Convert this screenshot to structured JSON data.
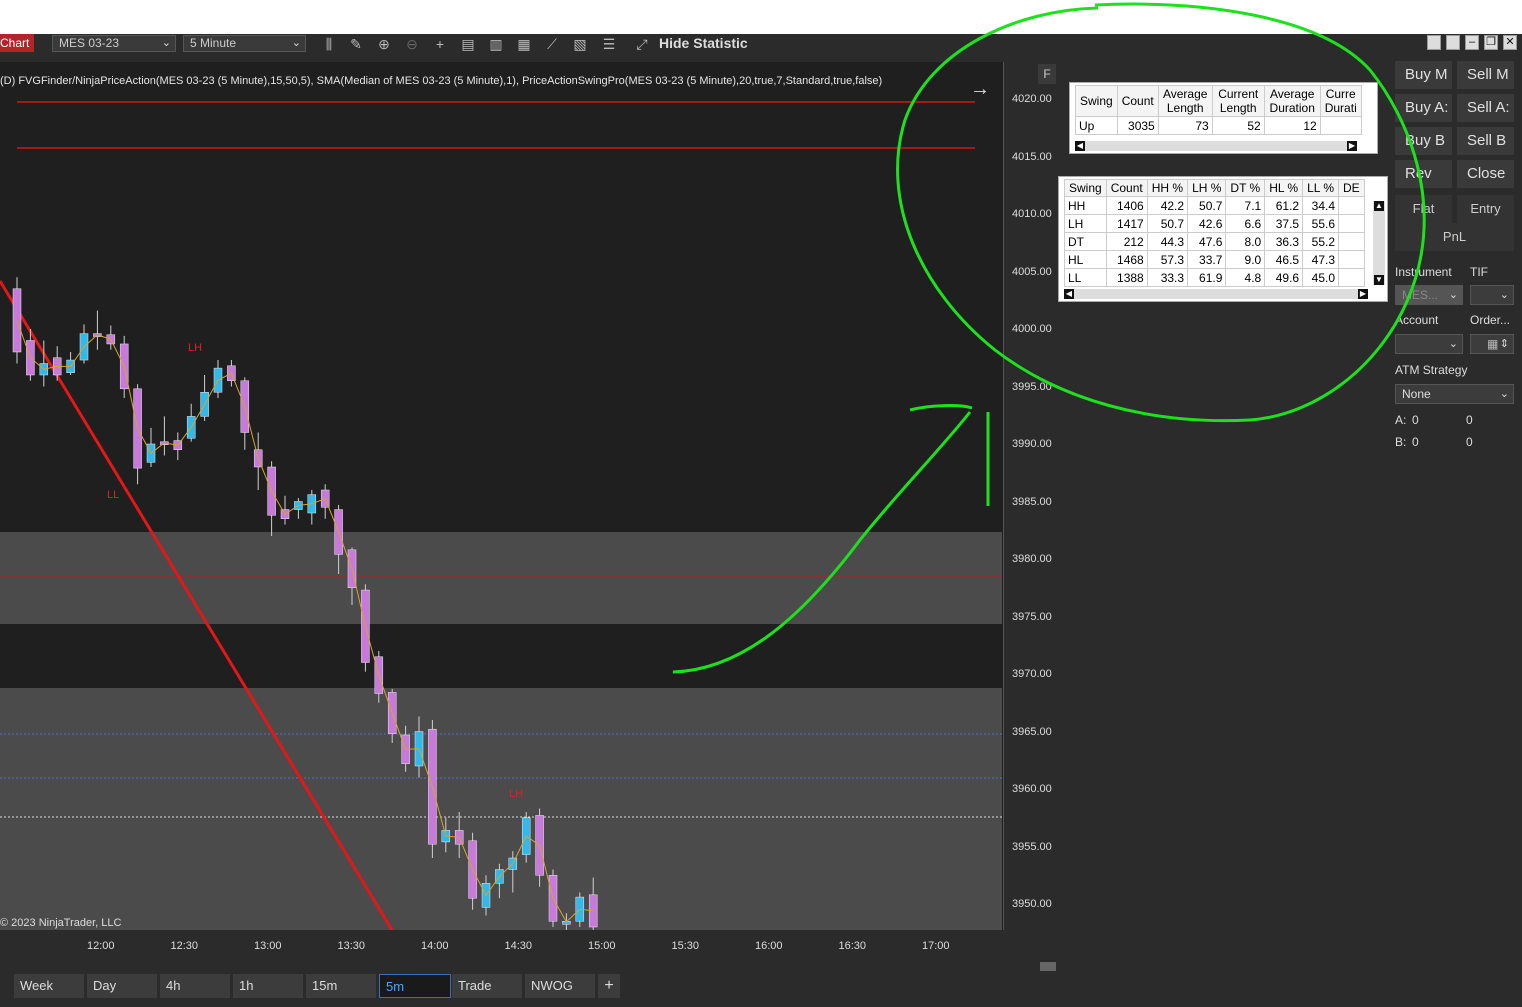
{
  "toolbar": {
    "chart_label": "Chart",
    "instrument": "MES 03-23",
    "interval": "5 Minute",
    "hide_statistic": "Hide Statistic"
  },
  "chart": {
    "legend": "(D) FVGFinder/NinjaPriceAction(MES 03-23 (5 Minute),15,50,5), SMA(Median of MES 03-23 (5 Minute),1), PriceActionSwingPro(MES 03-23 (5 Minute),20,true,7,Standard,true,false)",
    "f_button": "F",
    "copyright": "© 2023 NinjaTrader, LLC",
    "labels": {
      "lh1": "LH",
      "ll1": "LL",
      "lh2": "LH"
    },
    "y_ticks": [
      "4020.00",
      "4015.00",
      "4010.00",
      "4005.00",
      "4000.00",
      "3995.00",
      "3990.00",
      "3985.00",
      "3980.00",
      "3975.00",
      "3970.00",
      "3965.00",
      "3960.00",
      "3955.00",
      "3950.00"
    ],
    "x_ticks": [
      "12:00",
      "12:30",
      "13:00",
      "13:30",
      "14:00",
      "14:30",
      "15:00",
      "15:30",
      "16:00",
      "16:30",
      "17:00"
    ],
    "up_color": "#35b8e8",
    "down_color": "#c77ad9"
  },
  "stat_table_1": {
    "headers": [
      "Swing",
      "Count",
      "Average Length",
      "Current Length",
      "Average Duration",
      "Curre Durati"
    ],
    "row": [
      "Up",
      "3035",
      "73",
      "52",
      "12",
      ""
    ]
  },
  "stat_table_2": {
    "headers": [
      "Swing",
      "Count",
      "HH %",
      "LH %",
      "DT %",
      "HL %",
      "LL %",
      "DE"
    ],
    "rows": [
      [
        "HH",
        "1406",
        "42.2",
        "50.7",
        "7.1",
        "61.2",
        "34.4"
      ],
      [
        "LH",
        "1417",
        "50.7",
        "42.6",
        "6.6",
        "37.5",
        "55.6"
      ],
      [
        "DT",
        "212",
        "44.3",
        "47.6",
        "8.0",
        "36.3",
        "55.2"
      ],
      [
        "HL",
        "1468",
        "57.3",
        "33.7",
        "9.0",
        "46.5",
        "47.3"
      ],
      [
        "LL",
        "1388",
        "33.3",
        "61.9",
        "4.8",
        "49.6",
        "45.0"
      ]
    ]
  },
  "order_panel": {
    "buy_market": "Buy M",
    "sell_market": "Sell M",
    "buy_ask": "Buy A:",
    "sell_ask": "Sell A:",
    "buy_bid": "Buy B",
    "sell_bid": "Sell B",
    "rev": "Rev",
    "close": "Close",
    "flat": "Flat",
    "entry": "Entry",
    "pnl": "PnL",
    "instrument_label": "Instrument",
    "instrument_value": "MES...",
    "tif_label": "TIF",
    "account_label": "Account",
    "order_label": "Order...",
    "atm_label": "ATM Strategy",
    "atm_value": "None",
    "a_label": "A:",
    "a_val1": "0",
    "a_val2": "0",
    "b_label": "B:",
    "b_val1": "0",
    "b_val2": "0"
  },
  "tabs": [
    "Week",
    "Day",
    "4h",
    "1h",
    "15m",
    "5m",
    "Trade",
    "NWOG",
    "+"
  ]
}
